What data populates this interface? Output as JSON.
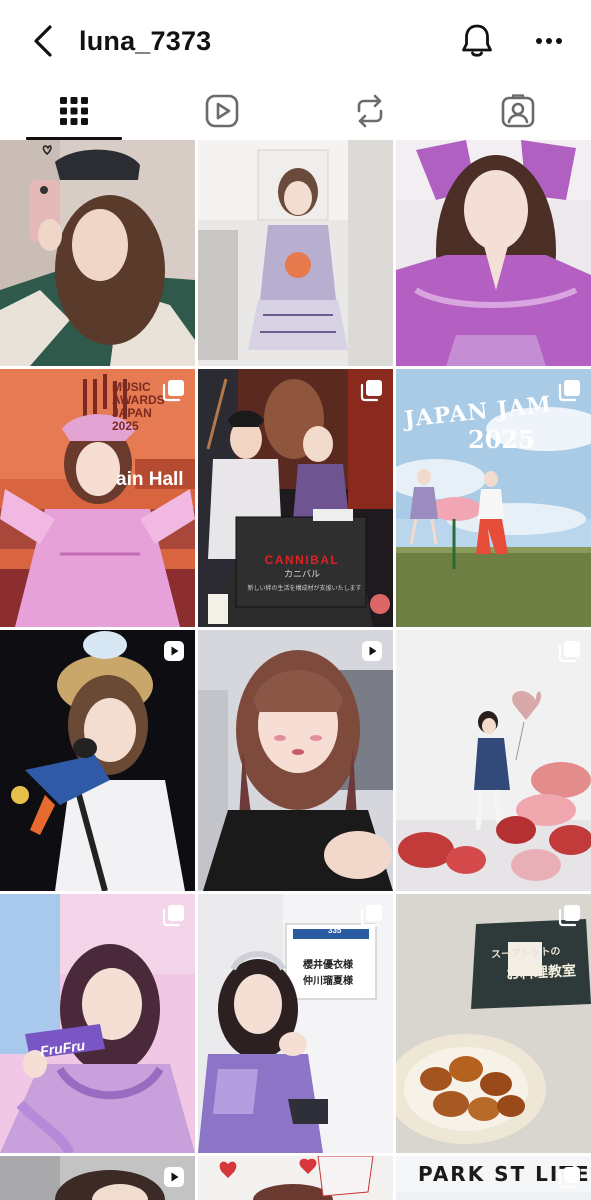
{
  "header": {
    "username": "luna_7373",
    "back_icon": "chevron-left-icon",
    "notification_icon": "bell-icon",
    "more_icon": "more-horizontal-icon"
  },
  "tabs": [
    {
      "name": "posts",
      "icon": "grid-icon",
      "active": true
    },
    {
      "name": "reels",
      "icon": "reels-play-icon",
      "active": false
    },
    {
      "name": "reposts",
      "icon": "repost-icon",
      "active": false
    },
    {
      "name": "tagged",
      "icon": "tagged-person-icon",
      "active": false
    }
  ],
  "grid": {
    "posts": [
      {
        "id": 1,
        "type": "photo",
        "badge": "none"
      },
      {
        "id": 2,
        "type": "photo",
        "badge": "none"
      },
      {
        "id": 3,
        "type": "photo",
        "badge": "none"
      },
      {
        "id": 4,
        "type": "carousel",
        "badge": "carousel-icon",
        "text": [
          "MUSIC",
          "AWARDS",
          "JAPAN",
          "2025",
          "ain Hall"
        ]
      },
      {
        "id": 5,
        "type": "carousel",
        "badge": "carousel-icon",
        "text": [
          "CANNIBAL",
          "カニバル",
          "新しい絆の生活を構成材が支援いたします"
        ]
      },
      {
        "id": 6,
        "type": "carousel",
        "badge": "carousel-icon",
        "text": [
          "JAPAN JAM",
          "2025"
        ]
      },
      {
        "id": 7,
        "type": "reel",
        "badge": "reel-icon"
      },
      {
        "id": 8,
        "type": "reel",
        "badge": "reel-icon"
      },
      {
        "id": 9,
        "type": "carousel",
        "badge": "carousel-icon"
      },
      {
        "id": 10,
        "type": "carousel",
        "badge": "carousel-icon",
        "text": [
          "FruFru"
        ]
      },
      {
        "id": 11,
        "type": "carousel",
        "badge": "carousel-icon",
        "text": [
          "335",
          "櫻井優衣様",
          "仲川瑠夏様"
        ]
      },
      {
        "id": 12,
        "type": "carousel",
        "badge": "carousel-icon",
        "text": [
          "スープトットの",
          "お料理教室"
        ]
      },
      {
        "id": 13,
        "type": "reel",
        "badge": "reel-icon"
      },
      {
        "id": 14,
        "type": "photo",
        "badge": "none"
      },
      {
        "id": 15,
        "type": "carousel",
        "badge": "carousel-icon",
        "text": [
          "PARK ST LITE"
        ]
      }
    ]
  },
  "colors": {
    "text": "#111111",
    "background": "#ffffff",
    "active_tab_indicator": "#111111"
  }
}
